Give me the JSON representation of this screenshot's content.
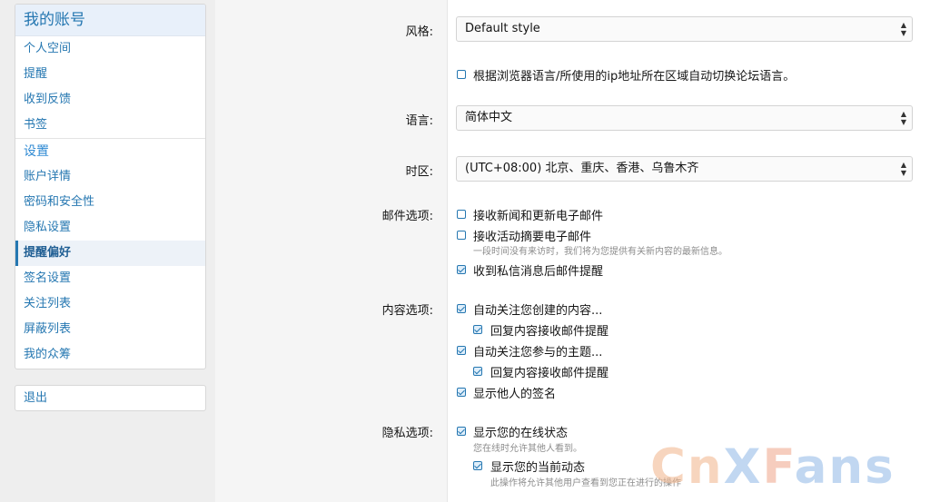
{
  "sidebar": {
    "title": "我的账号",
    "group1": [
      "个人空间",
      "提醒",
      "收到反馈",
      "书签"
    ],
    "section_settings": "设置",
    "group2": [
      "账户详情",
      "密码和安全性",
      "隐私设置",
      "提醒偏好",
      "签名设置",
      "关注列表",
      "屏蔽列表",
      "我的众筹"
    ],
    "active_item": "提醒偏好",
    "logout": "退出"
  },
  "form": {
    "style_label": "风格:",
    "style_value": "Default style",
    "auto_lang": "根据浏览器语言/所使用的ip地址所在区域自动切换论坛语言。",
    "language_label": "语言:",
    "language_value": "简体中文",
    "timezone_label": "时区:",
    "timezone_value": "(UTC+08:00) 北京、重庆、香港、乌鲁木齐",
    "email_label": "邮件选项:",
    "email_opts": {
      "news": "接收新闻和更新电子邮件",
      "digest": "接收活动摘要电子邮件",
      "digest_hint": "一段时间没有来访时，我们将为您提供有关新内容的最新信息。",
      "pm": "收到私信消息后邮件提醒"
    },
    "content_label": "内容选项:",
    "content_opts": {
      "watch_created": "自动关注您创建的内容...",
      "reply_email_1": "回复内容接收邮件提醒",
      "watch_interact": "自动关注您参与的主题...",
      "reply_email_2": "回复内容接收邮件提醒",
      "show_sigs": "显示他人的签名"
    },
    "privacy_label": "隐私选项:",
    "privacy_opts": {
      "online": "显示您的在线状态",
      "online_hint": "您在线时允许其他人看到。",
      "activity": "显示您的当前动态",
      "activity_hint": "此操作将允许其他用户查看到您正在进行的操作"
    }
  },
  "checks": {
    "auto_lang": false,
    "news": false,
    "digest": false,
    "pm": true,
    "watch_created": true,
    "reply_email_1": true,
    "watch_interact": true,
    "reply_email_2": true,
    "show_sigs": true,
    "online": true,
    "activity": true
  },
  "watermark": {
    "parts": [
      "Cn",
      "X",
      "F",
      "ans"
    ]
  },
  "colors": {
    "link": "#2577b1",
    "sidebar_head_bg": "#e8f0fa",
    "active_bg": "#edf2f8"
  }
}
